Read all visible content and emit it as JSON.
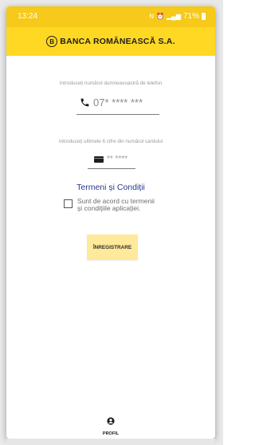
{
  "status_bar": {
    "time": "13:24",
    "battery": "71%",
    "background": "#f6c91a"
  },
  "app_bar": {
    "logo_text": "BANCA ROMÂNEASCĂ S.A.",
    "logo_mark": "B",
    "background": "#ffd823"
  },
  "form": {
    "phone_label": "Introduceți numărul dumneavoastră de telefon",
    "phone_placeholder": "07* **** ***",
    "phone_icon": "phone-icon",
    "card_label": "Introduceți ultimele 6 cifre din numărul cardului",
    "card_placeholder": "** ****",
    "card_icon": "credit-card-icon"
  },
  "terms": {
    "link_text": "Termeni și Condiții",
    "link_color": "#263a8d",
    "consent_line1": "Sunt de acord cu termenii",
    "consent_line2": "și condițiile aplicației."
  },
  "actions": {
    "register_label": "ÎNREGISTRARE",
    "register_color": "#ffe99a"
  },
  "bottom_nav": {
    "profile_label": "PROFIL",
    "profile_icon": "user-icon"
  }
}
